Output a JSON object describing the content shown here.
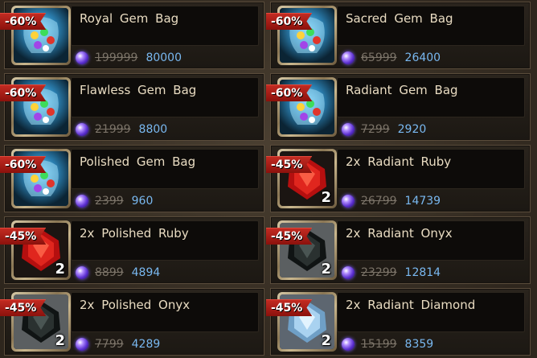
{
  "items": [
    {
      "name": "Royal Gem Bag",
      "discount": "-60%",
      "old_price": "199999",
      "new_price": "80000",
      "qty": "",
      "icon": "gem-bag-icon"
    },
    {
      "name": "Sacred Gem Bag",
      "discount": "-60%",
      "old_price": "65999",
      "new_price": "26400",
      "qty": "",
      "icon": "gem-bag-icon"
    },
    {
      "name": "Flawless Gem Bag",
      "discount": "-60%",
      "old_price": "21999",
      "new_price": "8800",
      "qty": "",
      "icon": "gem-bag-icon"
    },
    {
      "name": "Radiant Gem Bag",
      "discount": "-60%",
      "old_price": "7299",
      "new_price": "2920",
      "qty": "",
      "icon": "gem-bag-icon"
    },
    {
      "name": "Polished Gem Bag",
      "discount": "-60%",
      "old_price": "2399",
      "new_price": "960",
      "qty": "",
      "icon": "gem-bag-icon"
    },
    {
      "name": "2x Radiant Ruby",
      "discount": "-45%",
      "old_price": "26799",
      "new_price": "14739",
      "qty": "2",
      "icon": "ruby-icon"
    },
    {
      "name": "2x Polished Ruby",
      "discount": "-45%",
      "old_price": "8899",
      "new_price": "4894",
      "qty": "2",
      "icon": "ruby-icon"
    },
    {
      "name": "2x Radiant Onyx",
      "discount": "-45%",
      "old_price": "23299",
      "new_price": "12814",
      "qty": "2",
      "icon": "onyx-icon"
    },
    {
      "name": "2x Polished Onyx",
      "discount": "-45%",
      "old_price": "7799",
      "new_price": "4289",
      "qty": "2",
      "icon": "onyx-icon"
    },
    {
      "name": "2x Radiant Diamond",
      "discount": "-45%",
      "old_price": "15199",
      "new_price": "8359",
      "qty": "2",
      "icon": "diamond-icon"
    }
  ],
  "colors": {
    "discount_badge": "#b8231b",
    "new_price": "#79b8f0",
    "old_price": "#7b7368",
    "title": "#e9dcc2"
  }
}
